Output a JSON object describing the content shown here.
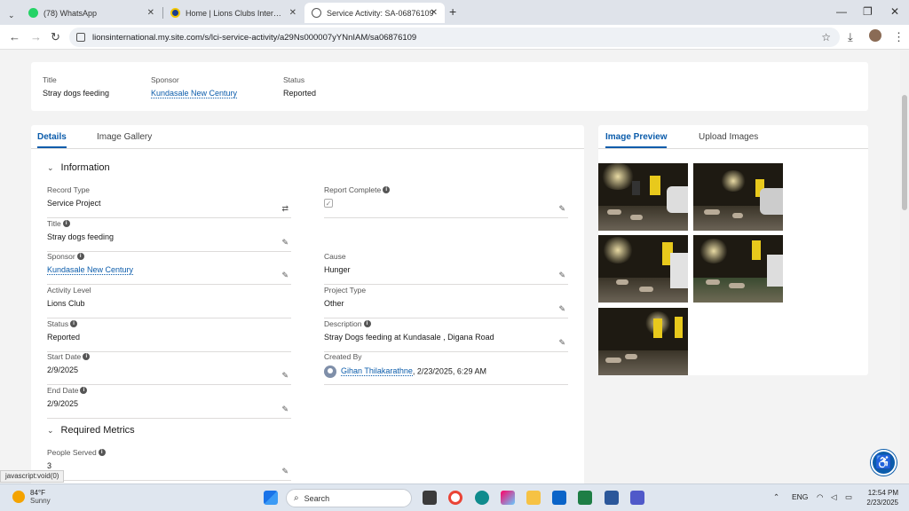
{
  "browser": {
    "tabs": [
      {
        "title": "(78) WhatsApp",
        "active": false
      },
      {
        "title": "Home | Lions Clubs Internation...",
        "active": false
      },
      {
        "title": "Service Activity: SA-06876109",
        "active": true
      }
    ],
    "url": "lionsinternational.my.site.com/s/lci-service-activity/a29Ns000007yYNnIAM/sa06876109"
  },
  "header": {
    "title_label": "Title",
    "title_value": "Stray dogs feeding",
    "sponsor_label": "Sponsor",
    "sponsor_value": "Kundasale New Century",
    "status_label": "Status",
    "status_value": "Reported"
  },
  "main_tabs": [
    "Details",
    "Image Gallery"
  ],
  "information": {
    "heading": "Information",
    "record_type_label": "Record Type",
    "record_type_value": "Service Project",
    "report_complete_label": "Report Complete",
    "title_label": "Title",
    "title_value": "Stray dogs feeding",
    "sponsor_label": "Sponsor",
    "sponsor_value": "Kundasale New Century",
    "cause_label": "Cause",
    "cause_value": "Hunger",
    "activity_level_label": "Activity Level",
    "activity_level_value": "Lions Club",
    "project_type_label": "Project Type",
    "project_type_value": "Other",
    "status_label": "Status",
    "status_value": "Reported",
    "description_label": "Description",
    "description_value": "Stray Dogs feeding at Kundasale , Digana Road",
    "start_date_label": "Start Date",
    "start_date_value": "2/9/2025",
    "created_by_label": "Created By",
    "created_by_name": "Gihan Thilakarathne",
    "created_by_date": ", 2/23/2025, 6:29 AM",
    "end_date_label": "End Date",
    "end_date_value": "2/9/2025"
  },
  "metrics": {
    "heading": "Required Metrics",
    "people_served_label": "People Served",
    "people_served_value": "3"
  },
  "side_tabs": [
    "Image Preview",
    "Upload Images"
  ],
  "status_tip": "javascript:void(0)",
  "taskbar": {
    "temperature": "84°F",
    "condition": "Sunny",
    "search_placeholder": "Search",
    "language": "ENG",
    "time": "12:54 PM",
    "date": "2/23/2025"
  }
}
